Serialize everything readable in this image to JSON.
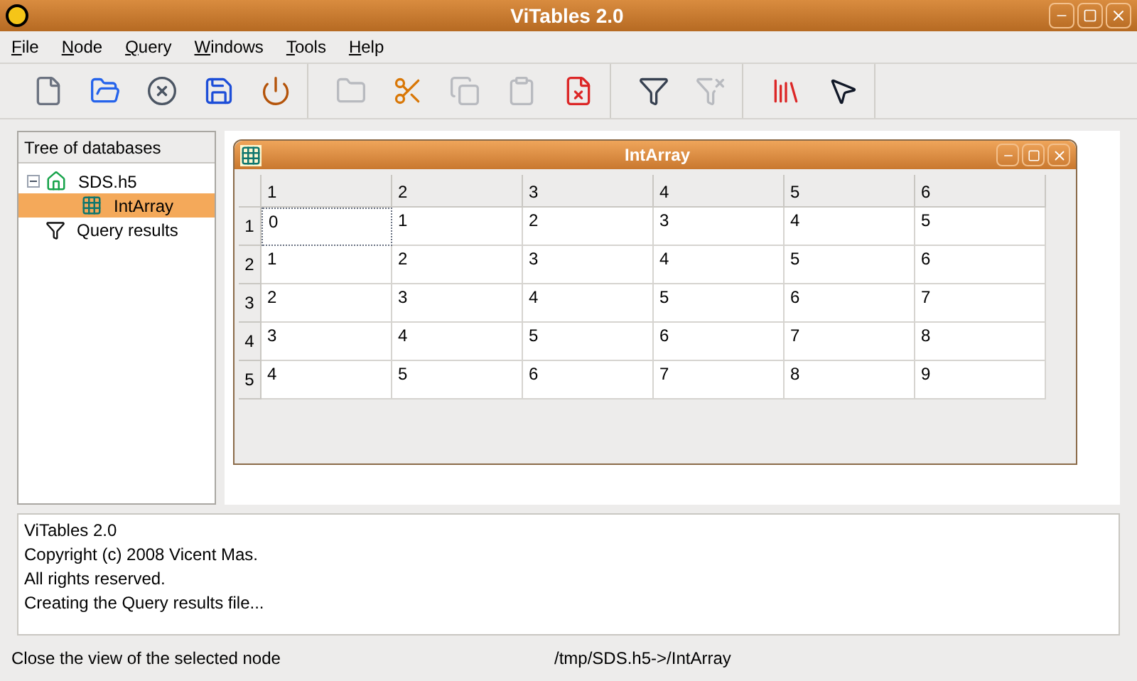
{
  "window": {
    "title": "ViTables 2.0"
  },
  "menu": [
    "File",
    "Node",
    "Query",
    "Windows",
    "Tools",
    "Help"
  ],
  "toolbar": [
    [
      {
        "kind": "new",
        "disabled": false
      },
      {
        "kind": "open",
        "disabled": false
      },
      {
        "kind": "close",
        "disabled": false
      },
      {
        "kind": "save",
        "disabled": false
      },
      {
        "kind": "quit",
        "disabled": false
      }
    ],
    [
      {
        "kind": "folder",
        "disabled": true
      },
      {
        "kind": "cut",
        "disabled": false
      },
      {
        "kind": "copy",
        "disabled": true
      },
      {
        "kind": "paste",
        "disabled": true
      },
      {
        "kind": "delete",
        "disabled": false
      }
    ],
    [
      {
        "kind": "query",
        "disabled": false
      },
      {
        "kind": "filter",
        "disabled": true
      }
    ],
    [
      {
        "kind": "books",
        "disabled": false
      },
      {
        "kind": "whatsthis",
        "disabled": false
      }
    ]
  ],
  "tree": {
    "header": "Tree of databases",
    "items": [
      {
        "label": "SDS.h5",
        "kind": "file",
        "expanded": true,
        "selected": false,
        "children": [
          {
            "label": "IntArray",
            "kind": "array",
            "selected": true
          }
        ]
      },
      {
        "label": "Query results",
        "kind": "query",
        "selected": false
      }
    ]
  },
  "subwindow": {
    "title": "IntArray",
    "columns": [
      "1",
      "2",
      "3",
      "4",
      "5",
      "6"
    ],
    "rows": [
      {
        "header": "1",
        "cells": [
          {
            "text": "0",
            "focused": true
          },
          {
            "text": "1",
            "focused": false
          },
          {
            "text": "2",
            "focused": false
          },
          {
            "text": "3",
            "focused": false
          },
          {
            "text": "4",
            "focused": false
          },
          {
            "text": "5",
            "focused": false
          }
        ]
      },
      {
        "header": "2",
        "cells": [
          {
            "text": "1",
            "focused": false
          },
          {
            "text": "2",
            "focused": false
          },
          {
            "text": "3",
            "focused": false
          },
          {
            "text": "4",
            "focused": false
          },
          {
            "text": "5",
            "focused": false
          },
          {
            "text": "6",
            "focused": false
          }
        ]
      },
      {
        "header": "3",
        "cells": [
          {
            "text": "2",
            "focused": false
          },
          {
            "text": "3",
            "focused": false
          },
          {
            "text": "4",
            "focused": false
          },
          {
            "text": "5",
            "focused": false
          },
          {
            "text": "6",
            "focused": false
          },
          {
            "text": "7",
            "focused": false
          }
        ]
      },
      {
        "header": "4",
        "cells": [
          {
            "text": "3",
            "focused": false
          },
          {
            "text": "4",
            "focused": false
          },
          {
            "text": "5",
            "focused": false
          },
          {
            "text": "6",
            "focused": false
          },
          {
            "text": "7",
            "focused": false
          },
          {
            "text": "8",
            "focused": false
          }
        ]
      },
      {
        "header": "5",
        "cells": [
          {
            "text": "4",
            "focused": false
          },
          {
            "text": "5",
            "focused": false
          },
          {
            "text": "6",
            "focused": false
          },
          {
            "text": "7",
            "focused": false
          },
          {
            "text": "8",
            "focused": false
          },
          {
            "text": "9",
            "focused": false
          }
        ]
      }
    ]
  },
  "log": [
    "ViTables 2.0",
    "Copyright (c) 2008 Vicent Mas.",
    "All rights reserved.",
    "Creating the Query results file..."
  ],
  "status_bar": {
    "message": "Close the view of the selected node",
    "path": "/tmp/SDS.h5->/IntArray"
  }
}
